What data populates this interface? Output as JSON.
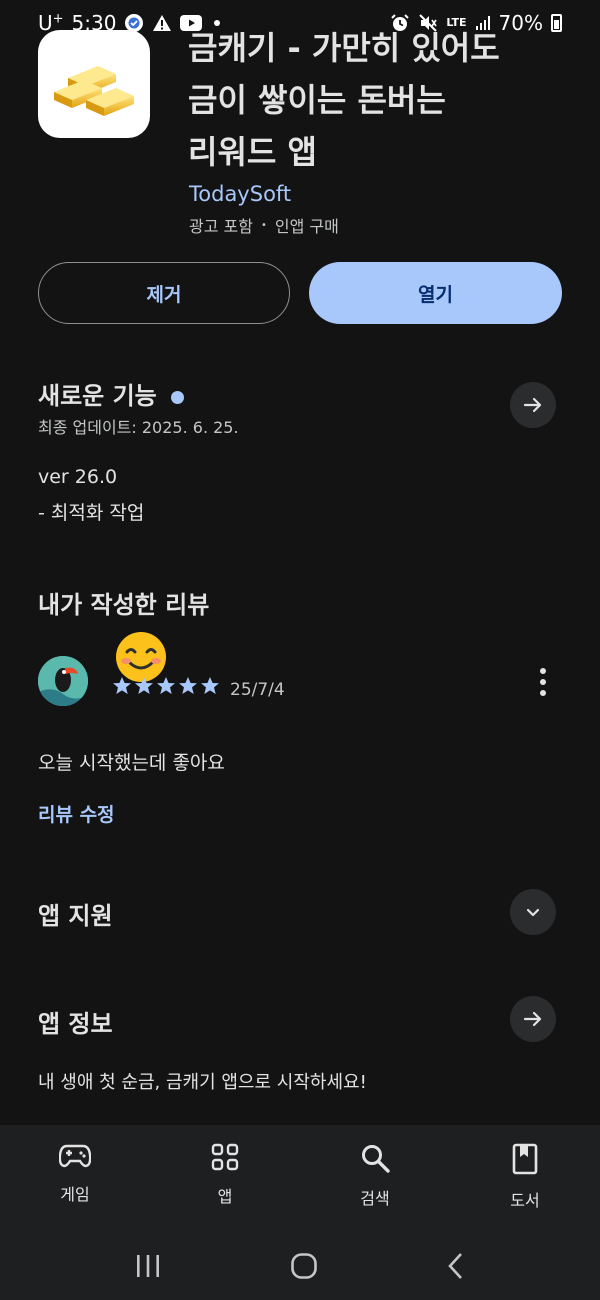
{
  "status_bar": {
    "carrier": "U",
    "carrier_sup": "+",
    "time": "5:30",
    "network": "LTE",
    "battery": "70%"
  },
  "app": {
    "title": "금캐기 - 가만히 있어도\n금이 쌓이는 돈버는\n리워드 앱",
    "developer": "TodaySoft",
    "meta_ads": "광고 포함",
    "meta_sep": "•",
    "meta_iap": "인앱 구매"
  },
  "actions": {
    "remove_label": "제거",
    "open_label": "열기"
  },
  "whats_new": {
    "title": "새로운 기능",
    "updated": "최종 업데이트: 2025. 6. 25.",
    "version": "ver 26.0",
    "notes": "- 최적화 작업"
  },
  "my_review": {
    "title": "내가 작성한 리뷰",
    "rating": 5,
    "date": "25/7/4",
    "text": "오늘 시작했는데 좋아요",
    "edit_link": "리뷰 수정"
  },
  "app_support": {
    "title": "앱 지원"
  },
  "app_info": {
    "title": "앱 정보",
    "description": "내 생애 첫 순금, 금캐기 앱으로 시작하세요!"
  },
  "bottom_nav": {
    "items": [
      {
        "label": "게임",
        "icon": "gamepad-icon"
      },
      {
        "label": "앱",
        "icon": "apps-grid-icon"
      },
      {
        "label": "검색",
        "icon": "search-icon"
      },
      {
        "label": "도서",
        "icon": "book-icon"
      }
    ]
  },
  "colors": {
    "background": "#131314",
    "accent": "#a8c7fa",
    "primary_button_text": "#062e6f",
    "surface": "#1e1f20"
  }
}
